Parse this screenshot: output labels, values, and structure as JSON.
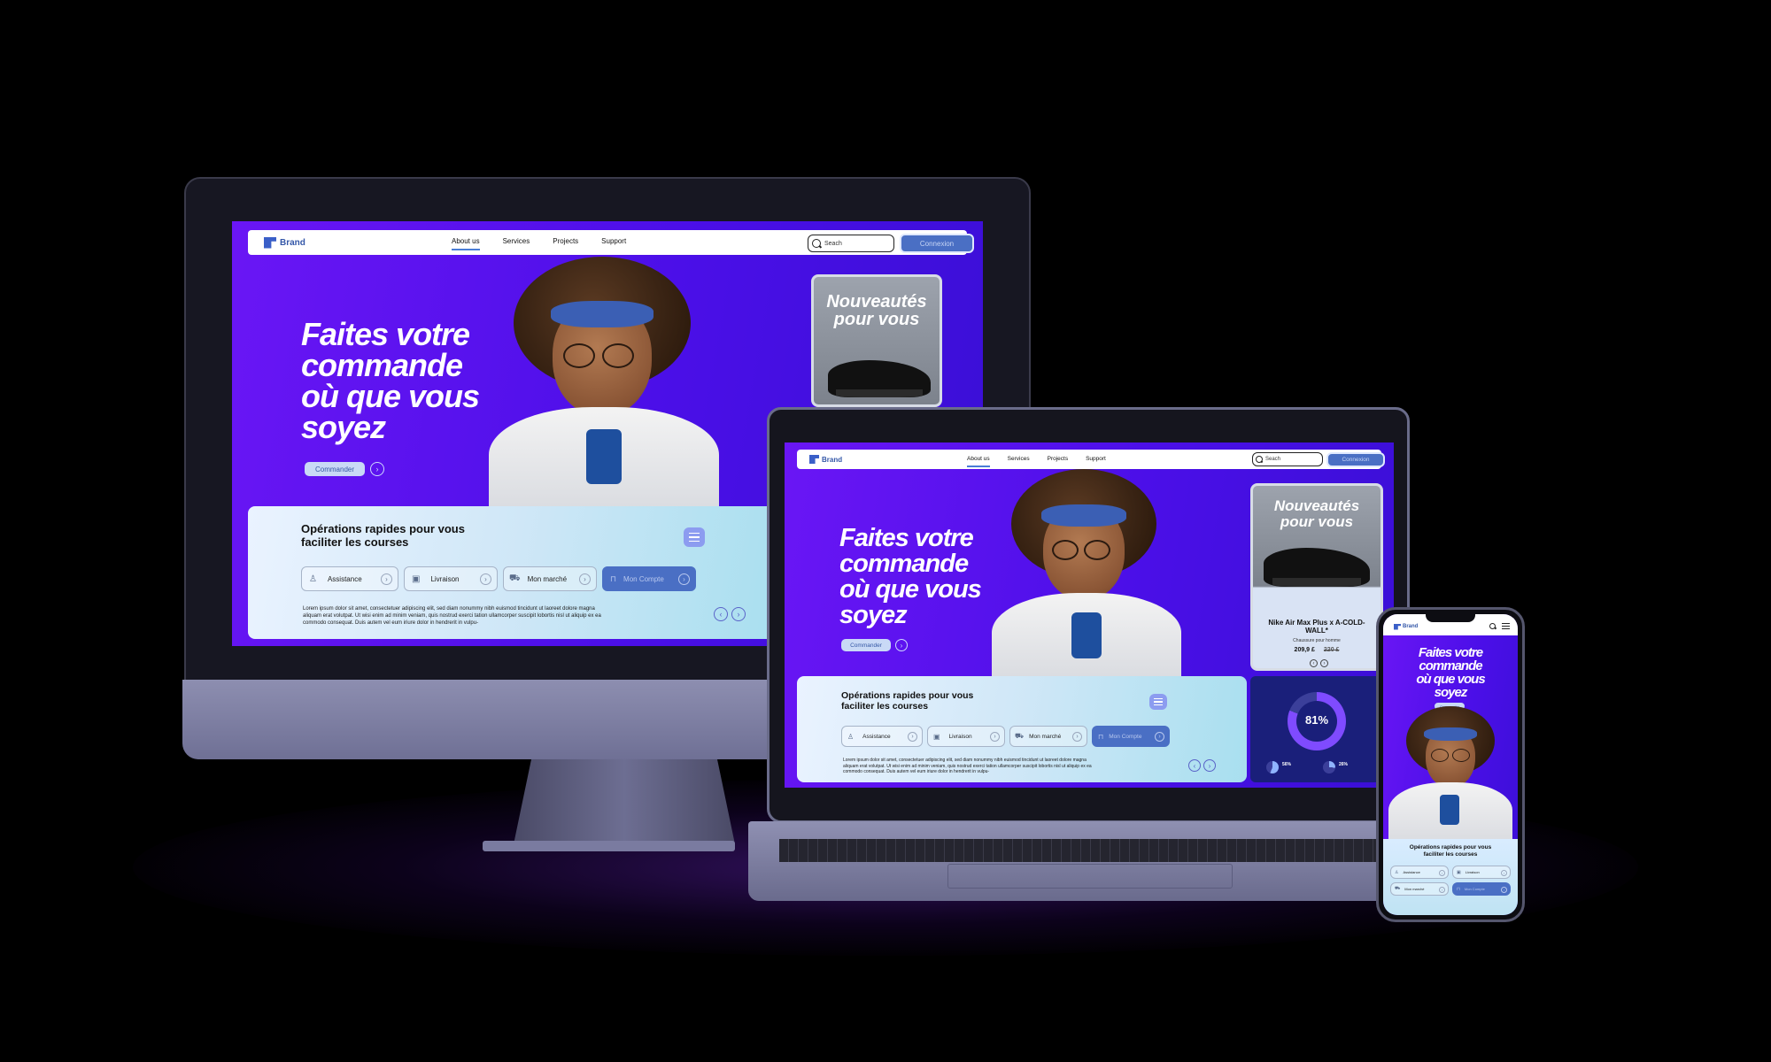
{
  "site": {
    "brand": "Brand",
    "nav": [
      "About us",
      "Services",
      "Projects",
      "Support"
    ],
    "search_placeholder": "Seach",
    "connect_label": "Connexion",
    "hero": {
      "title_lines": [
        "Faites votre",
        "commande",
        "où que vous",
        "soyez"
      ],
      "cta_label": "Commander"
    },
    "promo": {
      "title_lines": [
        "Nouveautés",
        "pour vous"
      ],
      "product_name": "Nike Air Max Plus x A-COLD-WALL*",
      "product_sub": "Chaussure pour homme",
      "price": "209,9 £",
      "old_price": "220 £"
    },
    "ops": {
      "title_lines": [
        "Opérations rapides pour vous",
        "faciliter les courses"
      ],
      "chips": [
        "Assistance",
        "Livraison",
        "Mon marché",
        "Mon Compte"
      ],
      "lorem": "Lorem ipsum dolor sit amet, consectetuer adipiscing elit, sed diam nonummy nibh euismod tincidunt ut laoreet dolore magna aliquam erat volutpat. Ut wisi enim ad minim veniam, quis nostrud exerci tation ullamcorper suscipit lobortis nisl ut aliquip ex ea commodo consequat. Duis autem vel eum iriure dolor in hendrerit in vulpu-"
    },
    "stats": {
      "main_value": "81%",
      "small_values": [
        "56%",
        "26%"
      ]
    }
  },
  "colors": {
    "hero_purple": "#5a12ee",
    "accent_blue": "#4a6fc4",
    "ops_bg": "#cfe7f7"
  },
  "icons": [
    "search-icon",
    "chevron-right-icon",
    "chevron-left-icon",
    "menu-icon",
    "user-icon",
    "box-icon",
    "cart-icon",
    "lock-icon"
  ]
}
